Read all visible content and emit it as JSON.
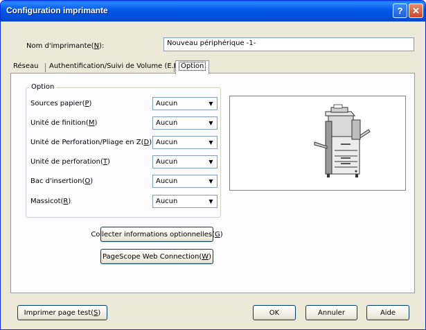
{
  "window": {
    "title": "Configuration imprimante",
    "help_button": "?",
    "close_button": "✕"
  },
  "printer_name": {
    "label_prefix": "Nom d'imprimante(",
    "label_key": "N",
    "label_suffix": "):",
    "value": "Nouveau périphérique -1-"
  },
  "tabs": [
    {
      "label": "Réseau"
    },
    {
      "label": "Authentification/Suivi de Volume (E.K.C)"
    },
    {
      "label": "Option"
    }
  ],
  "option_group": {
    "legend": "Option",
    "rows": [
      {
        "label_prefix": "Sources papier(",
        "key": "P",
        "label_suffix": ")",
        "value": "Aucun"
      },
      {
        "label_prefix": "Unité de finition(",
        "key": "M",
        "label_suffix": ")",
        "value": "Aucun"
      },
      {
        "label_prefix": "Unité de Perforation/Pliage en Z(",
        "key": "D",
        "label_suffix": ")",
        "value": "Aucun"
      },
      {
        "label_prefix": "Unité de perforation(",
        "key": "T",
        "label_suffix": ")",
        "value": "Aucun"
      },
      {
        "label_prefix": "Bac d'insertion(",
        "key": "O",
        "label_suffix": ")",
        "value": "Aucun"
      },
      {
        "label_prefix": "Massicot(",
        "key": "R",
        "label_suffix": ")",
        "value": "Aucun"
      }
    ]
  },
  "buttons": {
    "collect_prefix": "Collecter informations optionnelles(",
    "collect_key": "G",
    "collect_suffix": ")",
    "pagescope_prefix": "PageScope Web Connection(",
    "pagescope_key": "W",
    "pagescope_suffix": ")",
    "test_prefix": "Imprimer page test(",
    "test_key": "S",
    "test_suffix": ")",
    "ok": "OK",
    "cancel": "Annuler",
    "help": "Aide"
  },
  "icons": {
    "combo_arrow": "▼"
  },
  "colors": {
    "titlebar": "#0058e6",
    "dialog_bg": "#ece9d8",
    "panel_bg": "#fcfcfe"
  }
}
